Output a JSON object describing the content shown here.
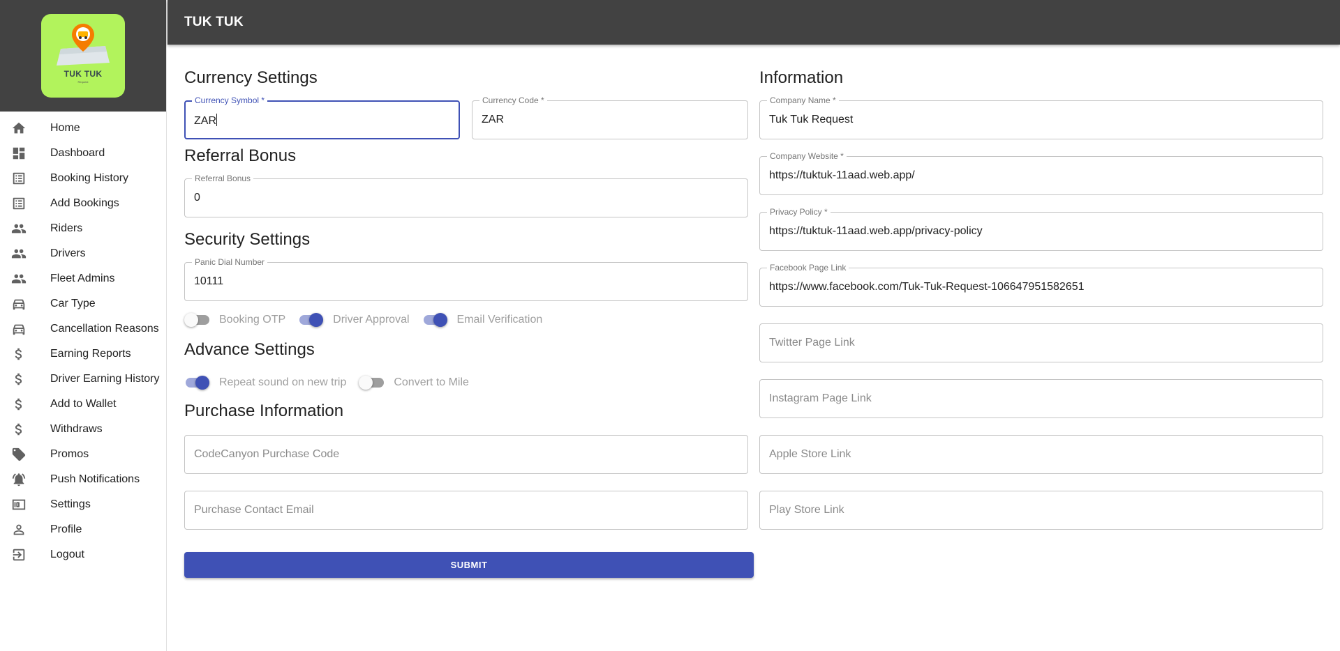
{
  "app": {
    "title": "TUK TUK"
  },
  "logo": {
    "text": "TUK TUK",
    "sub": "Request"
  },
  "sidebar": {
    "items": [
      {
        "label": "Home",
        "icon": "home-icon"
      },
      {
        "label": "Dashboard",
        "icon": "dashboard-icon"
      },
      {
        "label": "Booking History",
        "icon": "list-icon"
      },
      {
        "label": "Add Bookings",
        "icon": "list-icon"
      },
      {
        "label": "Riders",
        "icon": "people-icon"
      },
      {
        "label": "Drivers",
        "icon": "people-icon"
      },
      {
        "label": "Fleet Admins",
        "icon": "people-icon"
      },
      {
        "label": "Car Type",
        "icon": "car-icon"
      },
      {
        "label": "Cancellation Reasons",
        "icon": "car-icon"
      },
      {
        "label": "Earning Reports",
        "icon": "dollar-icon"
      },
      {
        "label": "Driver Earning History",
        "icon": "dollar-icon"
      },
      {
        "label": "Add to Wallet",
        "icon": "dollar-icon"
      },
      {
        "label": "Withdraws",
        "icon": "dollar-icon"
      },
      {
        "label": "Promos",
        "icon": "tag-icon"
      },
      {
        "label": "Push Notifications",
        "icon": "bell-icon"
      },
      {
        "label": "Settings",
        "icon": "money-icon"
      },
      {
        "label": "Profile",
        "icon": "person-icon"
      },
      {
        "label": "Logout",
        "icon": "logout-icon"
      }
    ]
  },
  "currency": {
    "title": "Currency Settings",
    "symbol": {
      "label": "Currency Symbol *",
      "value": "ZAR"
    },
    "code": {
      "label": "Currency Code *",
      "value": "ZAR"
    }
  },
  "referral": {
    "title": "Referral Bonus",
    "bonus": {
      "label": "Referral Bonus",
      "value": "0"
    }
  },
  "security": {
    "title": "Security Settings",
    "panic": {
      "label": "Panic Dial Number",
      "value": "10111"
    },
    "switches": [
      {
        "label": "Booking OTP",
        "on": false
      },
      {
        "label": "Driver Approval",
        "on": true
      },
      {
        "label": "Email Verification",
        "on": true
      }
    ]
  },
  "advance": {
    "title": "Advance Settings",
    "switches": [
      {
        "label": "Repeat sound on new trip",
        "on": true
      },
      {
        "label": "Convert to Mile",
        "on": false
      }
    ]
  },
  "purchase": {
    "title": "Purchase Information",
    "code_placeholder": "CodeCanyon Purchase Code",
    "email_placeholder": "Purchase Contact Email"
  },
  "submit_label": "SUBMIT",
  "information": {
    "title": "Information",
    "company_name": {
      "label": "Company Name *",
      "value": "Tuk Tuk Request"
    },
    "company_website": {
      "label": "Company Website *",
      "value": "https://tuktuk-11aad.web.app/"
    },
    "privacy_policy": {
      "label": "Privacy Policy *",
      "value": "https://tuktuk-11aad.web.app/privacy-policy"
    },
    "facebook": {
      "label": "Facebook Page Link",
      "value": "https://www.facebook.com/Tuk-Tuk-Request-106647951582651"
    },
    "twitter_placeholder": "Twitter Page Link",
    "instagram_placeholder": "Instagram Page Link",
    "apple_placeholder": "Apple Store Link",
    "play_placeholder": "Play Store Link"
  },
  "colors": {
    "primary": "#3f51b5",
    "appbar": "#424242",
    "logo_bg": "#b2f35c"
  }
}
